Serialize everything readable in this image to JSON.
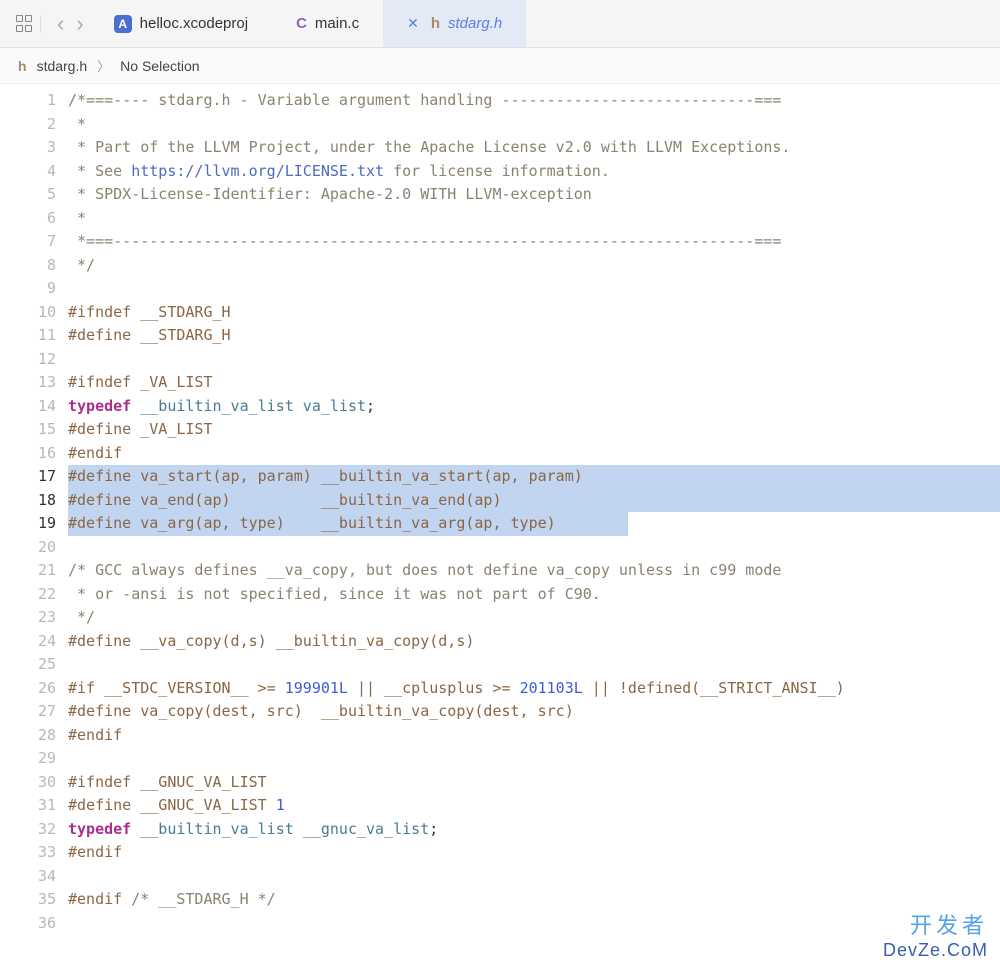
{
  "tabs": [
    {
      "label": "helloc.xcodeproj",
      "icon": "proj"
    },
    {
      "label": "main.c",
      "icon": "c"
    },
    {
      "label": "stdarg.h",
      "icon": "h",
      "active": true
    }
  ],
  "breadcrumb": {
    "file": "stdarg.h",
    "selection": "No Selection"
  },
  "code_lines": [
    {
      "n": 1,
      "hl": false,
      "segs": [
        {
          "c": "c-comment",
          "t": "/*===---- stdarg.h - Variable argument handling ----------------------------==="
        }
      ]
    },
    {
      "n": 2,
      "hl": false,
      "segs": [
        {
          "c": "c-comment",
          "t": " *"
        }
      ]
    },
    {
      "n": 3,
      "hl": false,
      "segs": [
        {
          "c": "c-comment",
          "t": " * Part of the LLVM Project, under the Apache License v2.0 with LLVM Exceptions."
        }
      ]
    },
    {
      "n": 4,
      "hl": false,
      "segs": [
        {
          "c": "c-comment",
          "t": " * See "
        },
        {
          "c": "c-url",
          "t": "https://llvm.org/LICENSE.txt"
        },
        {
          "c": "c-comment",
          "t": " for license information."
        }
      ]
    },
    {
      "n": 5,
      "hl": false,
      "segs": [
        {
          "c": "c-comment",
          "t": " * SPDX-License-Identifier: Apache-2.0 WITH LLVM-exception"
        }
      ]
    },
    {
      "n": 6,
      "hl": false,
      "segs": [
        {
          "c": "c-comment",
          "t": " *"
        }
      ]
    },
    {
      "n": 7,
      "hl": false,
      "segs": [
        {
          "c": "c-comment",
          "t": " *===-----------------------------------------------------------------------==="
        }
      ]
    },
    {
      "n": 8,
      "hl": false,
      "segs": [
        {
          "c": "c-comment",
          "t": " */"
        }
      ]
    },
    {
      "n": 9,
      "hl": false,
      "segs": []
    },
    {
      "n": 10,
      "hl": false,
      "segs": [
        {
          "c": "c-pp",
          "t": "#ifndef __STDARG_H"
        }
      ]
    },
    {
      "n": 11,
      "hl": false,
      "segs": [
        {
          "c": "c-pp",
          "t": "#define __STDARG_H"
        }
      ]
    },
    {
      "n": 12,
      "hl": false,
      "segs": []
    },
    {
      "n": 13,
      "hl": false,
      "segs": [
        {
          "c": "c-pp",
          "t": "#ifndef _VA_LIST"
        }
      ]
    },
    {
      "n": 14,
      "hl": false,
      "segs": [
        {
          "c": "c-keyword",
          "t": "typedef"
        },
        {
          "c": "c-plain",
          "t": " "
        },
        {
          "c": "c-type",
          "t": "__builtin_va_list va_list"
        },
        {
          "c": "c-plain",
          "t": ";"
        }
      ]
    },
    {
      "n": 15,
      "hl": false,
      "segs": [
        {
          "c": "c-pp",
          "t": "#define _VA_LIST"
        }
      ]
    },
    {
      "n": 16,
      "hl": false,
      "segs": [
        {
          "c": "c-pp",
          "t": "#endif"
        }
      ]
    },
    {
      "n": 17,
      "hl": true,
      "hlw": "full",
      "current": true,
      "segs": [
        {
          "c": "c-pp",
          "t": "#define va_start(ap, param) __builtin_va_start(ap, param)"
        }
      ]
    },
    {
      "n": 18,
      "hl": true,
      "hlw": "full",
      "current": true,
      "segs": [
        {
          "c": "c-pp",
          "t": "#define va_end(ap)          __builtin_va_end(ap)"
        }
      ]
    },
    {
      "n": 19,
      "hl": true,
      "hlw": "560",
      "current": true,
      "segs": [
        {
          "c": "c-pp",
          "t": "#define va_arg(ap, type)    __builtin_va_arg(ap, type)"
        }
      ]
    },
    {
      "n": 20,
      "hl": false,
      "segs": []
    },
    {
      "n": 21,
      "hl": false,
      "segs": [
        {
          "c": "c-comment",
          "t": "/* GCC always defines __va_copy, but does not define va_copy unless in c99 mode"
        }
      ]
    },
    {
      "n": 22,
      "hl": false,
      "segs": [
        {
          "c": "c-comment",
          "t": " * or -ansi is not specified, since it was not part of C90."
        }
      ]
    },
    {
      "n": 23,
      "hl": false,
      "segs": [
        {
          "c": "c-comment",
          "t": " */"
        }
      ]
    },
    {
      "n": 24,
      "hl": false,
      "segs": [
        {
          "c": "c-pp",
          "t": "#define __va_copy(d,s) __builtin_va_copy(d,s)"
        }
      ]
    },
    {
      "n": 25,
      "hl": false,
      "segs": []
    },
    {
      "n": 26,
      "hl": false,
      "segs": [
        {
          "c": "c-pp",
          "t": "#if __STDC_VERSION__ >= "
        },
        {
          "c": "c-num",
          "t": "199901L"
        },
        {
          "c": "c-pp",
          "t": " || __cplusplus >= "
        },
        {
          "c": "c-num",
          "t": "201103L"
        },
        {
          "c": "c-pp",
          "t": " || !defined(__STRICT_ANSI__)"
        }
      ]
    },
    {
      "n": 27,
      "hl": false,
      "segs": [
        {
          "c": "c-pp",
          "t": "#define va_copy(dest, src)  __builtin_va_copy(dest, src)"
        }
      ]
    },
    {
      "n": 28,
      "hl": false,
      "segs": [
        {
          "c": "c-pp",
          "t": "#endif"
        }
      ]
    },
    {
      "n": 29,
      "hl": false,
      "segs": []
    },
    {
      "n": 30,
      "hl": false,
      "segs": [
        {
          "c": "c-pp",
          "t": "#ifndef __GNUC_VA_LIST"
        }
      ]
    },
    {
      "n": 31,
      "hl": false,
      "segs": [
        {
          "c": "c-pp",
          "t": "#define __GNUC_VA_LIST "
        },
        {
          "c": "c-num",
          "t": "1"
        }
      ]
    },
    {
      "n": 32,
      "hl": false,
      "segs": [
        {
          "c": "c-keyword",
          "t": "typedef"
        },
        {
          "c": "c-plain",
          "t": " "
        },
        {
          "c": "c-type",
          "t": "__builtin_va_list __gnuc_va_list"
        },
        {
          "c": "c-plain",
          "t": ";"
        }
      ]
    },
    {
      "n": 33,
      "hl": false,
      "segs": [
        {
          "c": "c-pp",
          "t": "#endif"
        }
      ]
    },
    {
      "n": 34,
      "hl": false,
      "segs": []
    },
    {
      "n": 35,
      "hl": false,
      "segs": [
        {
          "c": "c-pp",
          "t": "#endif "
        },
        {
          "c": "c-comment",
          "t": "/* __STDARG_H */"
        }
      ]
    },
    {
      "n": 36,
      "hl": false,
      "segs": []
    }
  ],
  "watermark": {
    "line1": "开发者",
    "line2": "DevZe.CoM"
  }
}
